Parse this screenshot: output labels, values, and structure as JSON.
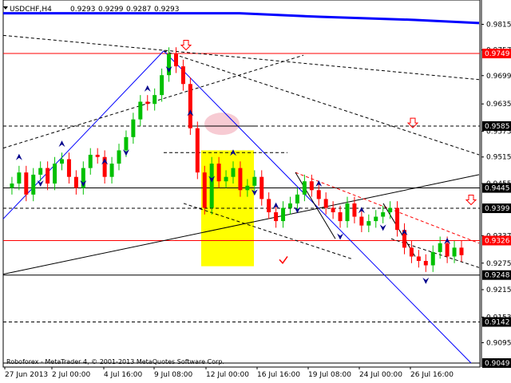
{
  "header": {
    "symbol_label": "USDCHF,H4",
    "ohlc": [
      "0.9293",
      "0.9299",
      "0.9287",
      "0.9293"
    ]
  },
  "copyright": "Roboforex - MetaTrader 4, © 2001-2013 MetaQuotes Software Corp.",
  "colors": {
    "bull": "#00c000",
    "bear": "#ff0000",
    "mark": "#00008b",
    "trend_blue": "#0000ff",
    "level_red": "#ff0000",
    "highlight_yellow": "#ffff00",
    "highlight_pink": "#f4b5c0",
    "flag_bg": "#ff0000",
    "current_bg": "#ff0000",
    "tick_bg": "#000000"
  },
  "chart_data": {
    "type": "candlestick",
    "ylim": [
      0.904,
      0.987
    ],
    "y_ticks": [
      "0.9815",
      "0.9757",
      "0.9699",
      "0.9635",
      "0.9573",
      "0.9515",
      "0.9455",
      "0.9337",
      "0.9275",
      "0.9215",
      "0.9153",
      "0.9095"
    ],
    "x_tick_labels": [
      "27 Jun 2013",
      "2 Jul 00:00",
      "4 Jul 16:00",
      "9 Jul 08:00",
      "12 Jul 00:00",
      "16 Jul 16:00",
      "19 Jul 08:00",
      "24 Jul 00:00",
      "26 Jul 16:00"
    ],
    "level_lines": [
      {
        "label": "0.9749",
        "value": 0.9749,
        "style": "solid",
        "color": "red"
      },
      {
        "label": "0.9585",
        "value": 0.9585,
        "style": "dashed",
        "color": "black"
      },
      {
        "label": "0.9445",
        "value": 0.9445,
        "style": "solid",
        "color": "black"
      },
      {
        "label": "0.9399",
        "value": 0.9399,
        "style": "dashed",
        "color": "black"
      },
      {
        "label": "0.9326",
        "value": 0.9326,
        "style": "solid",
        "color": "red"
      },
      {
        "label": "0.9248",
        "value": 0.9248,
        "style": "solid",
        "color": "black"
      },
      {
        "label": "0.9142",
        "value": 0.9142,
        "style": "dashed",
        "color": "black"
      },
      {
        "label": "0.9049",
        "value": 0.9049,
        "style": "solid",
        "color": "black"
      }
    ],
    "current_price": "0.9293",
    "price_path": [
      0.9445,
      0.9455,
      0.948,
      0.943,
      0.9475,
      0.949,
      0.9455,
      0.95,
      0.951,
      0.947,
      0.9445,
      0.949,
      0.952,
      0.9515,
      0.947,
      0.95,
      0.953,
      0.956,
      0.96,
      0.964,
      0.9635,
      0.9655,
      0.97,
      0.9748,
      0.972,
      0.968,
      0.958,
      0.948,
      0.94,
      0.95,
      0.946,
      0.947,
      0.949,
      0.944,
      0.945,
      0.947,
      0.942,
      0.939,
      0.937,
      0.94,
      0.941,
      0.943,
      0.946,
      0.944,
      0.942,
      0.94,
      0.939,
      0.937,
      0.941,
      0.938,
      0.936,
      0.937,
      0.938,
      0.939,
      0.94,
      0.935,
      0.931,
      0.929,
      0.928,
      0.927,
      0.93,
      0.932,
      0.929,
      0.931,
      0.9293
    ]
  }
}
